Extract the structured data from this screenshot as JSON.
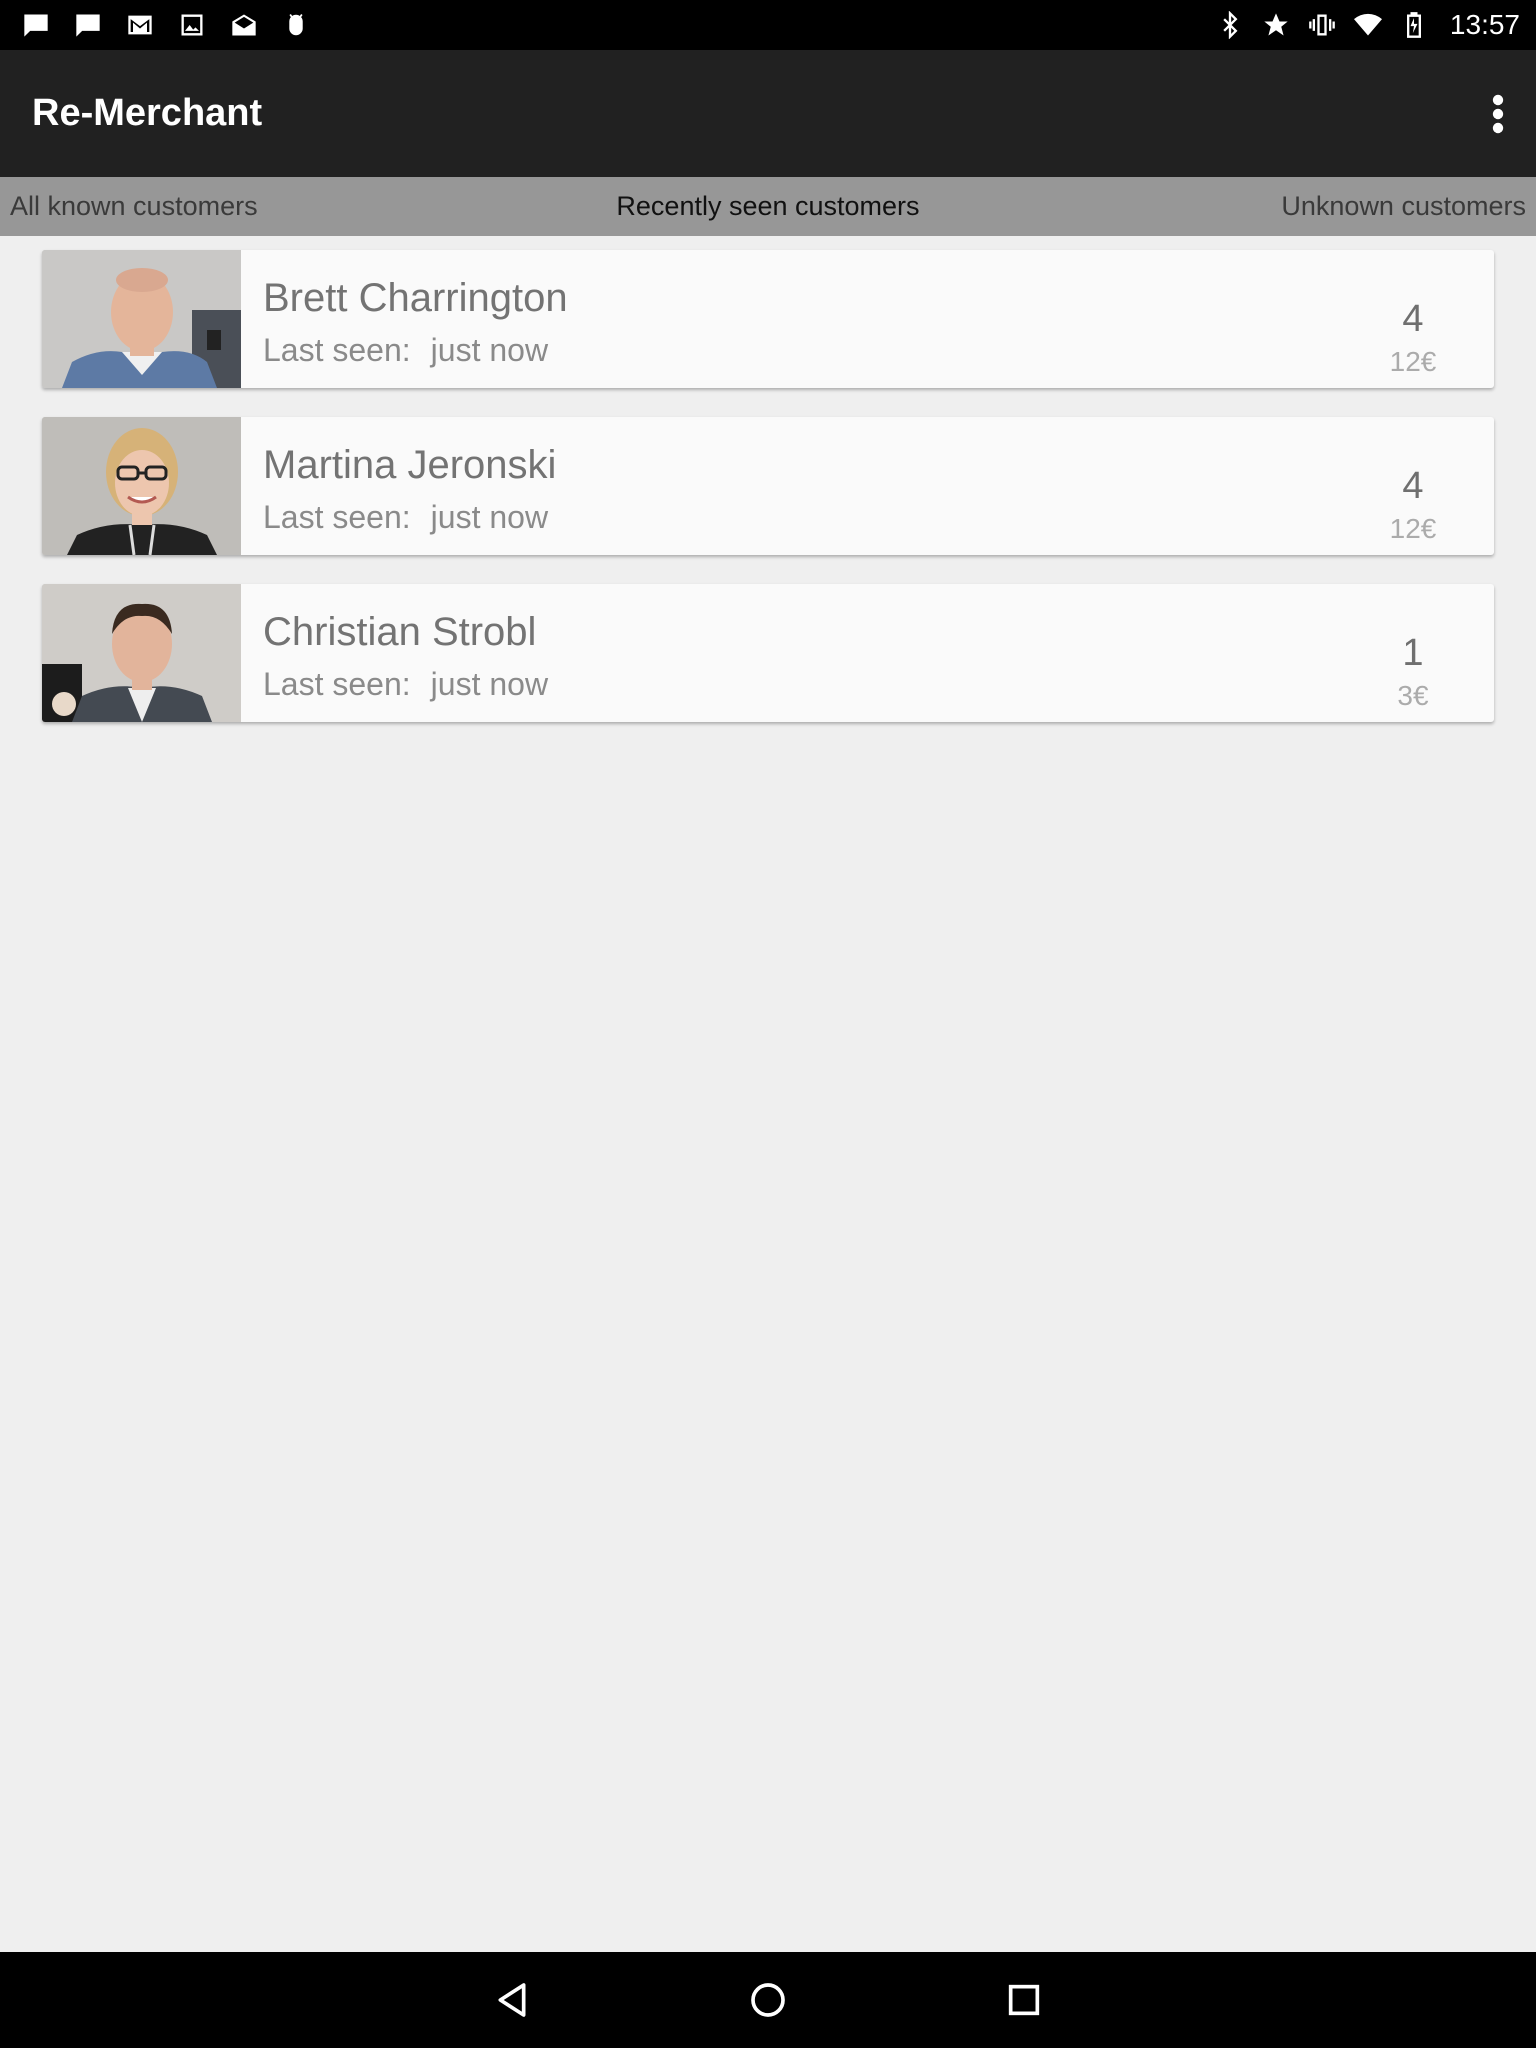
{
  "status_bar": {
    "time": "13:57",
    "left_icons": [
      "chat-icon",
      "chat-icon",
      "gmail-icon",
      "image-icon",
      "mail-open-icon",
      "android-debug-icon"
    ],
    "right_icons": [
      "bluetooth-icon",
      "star-icon",
      "vibrate-icon",
      "wifi-icon",
      "battery-icon"
    ]
  },
  "app_bar": {
    "title": "Re-Merchant",
    "overflow_icon": "more-vert-icon"
  },
  "tabs": [
    {
      "label": "All known customers",
      "active": false
    },
    {
      "label": "Recently seen customers",
      "active": true
    },
    {
      "label": "Unknown customers",
      "active": false
    }
  ],
  "customers": [
    {
      "name": "Brett Charrington",
      "last_seen_label": "Last seen:",
      "last_seen_value": "just now",
      "visits": "4",
      "spent": "12€"
    },
    {
      "name": "Martina Jeronski",
      "last_seen_label": "Last seen:",
      "last_seen_value": "just now",
      "visits": "4",
      "spent": "12€"
    },
    {
      "name": "Christian Strobl",
      "last_seen_label": "Last seen:",
      "last_seen_value": "just now",
      "visits": "1",
      "spent": "3€"
    }
  ],
  "nav_bar": {
    "icons": [
      "back-icon",
      "home-icon",
      "recents-icon"
    ]
  },
  "colors": {
    "app_bar": "#212121",
    "tab_strip": "#979797",
    "background": "#efefef",
    "card": "#fafafa"
  }
}
